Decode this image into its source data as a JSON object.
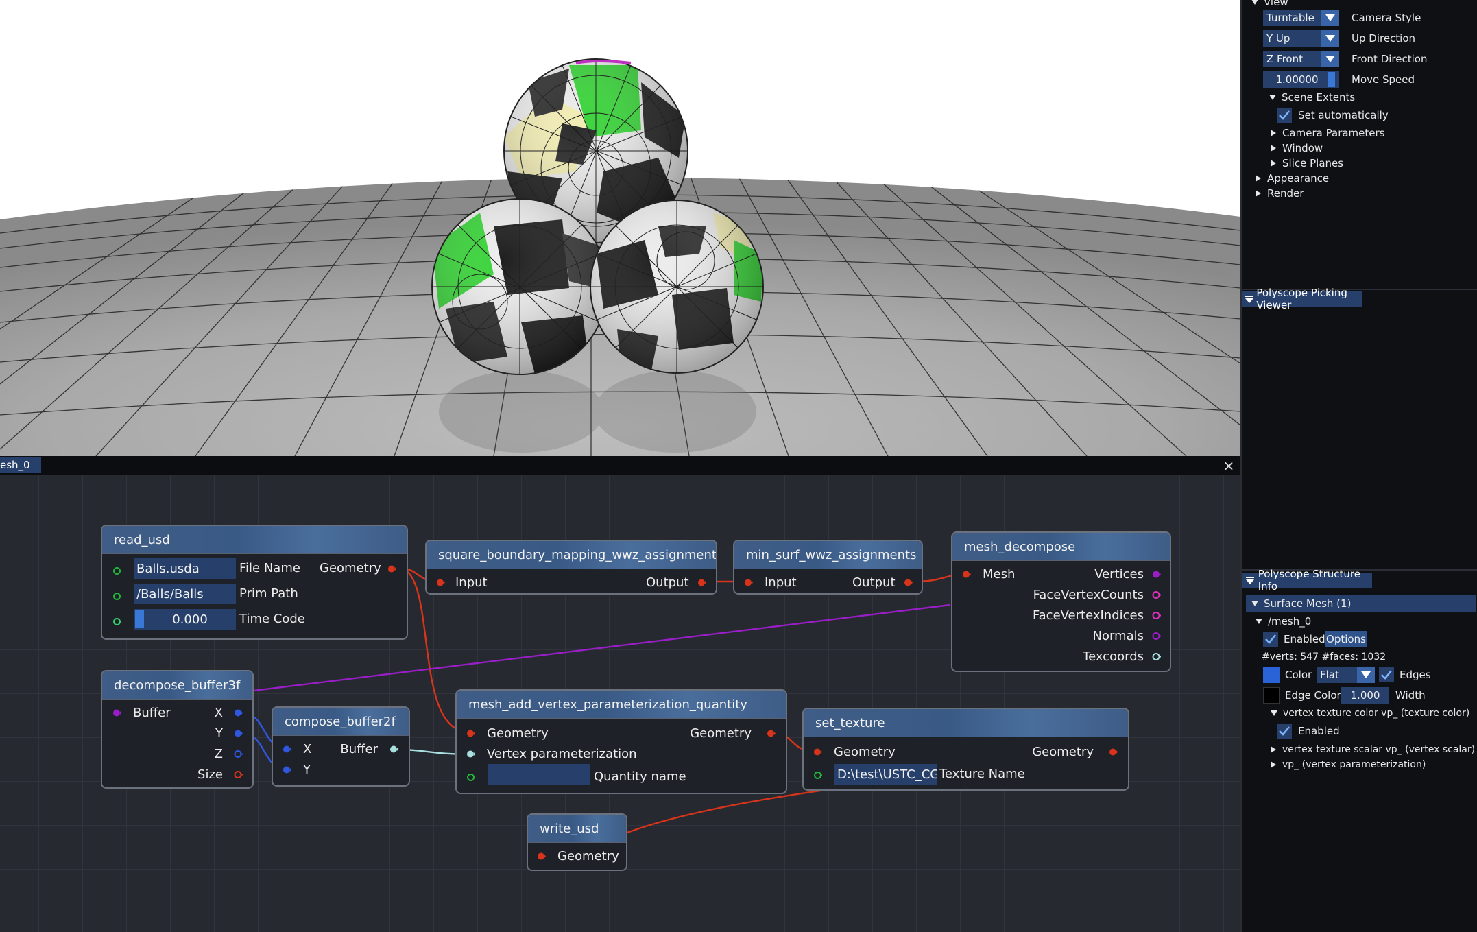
{
  "right_panel": {
    "view_section": {
      "title": "View",
      "camera_style": {
        "value": "Turntable",
        "label": "Camera Style"
      },
      "up_direction": {
        "value": "Y Up",
        "label": "Up Direction"
      },
      "front_direction": {
        "value": "Z Front",
        "label": "Front Direction"
      },
      "move_speed": {
        "value": "1.00000",
        "label": "Move Speed"
      },
      "scene_extents": {
        "label": "Scene Extents",
        "set_automatically": "Set automatically"
      },
      "collapsed_items": [
        "Camera Parameters",
        "Window",
        "Slice Planes"
      ],
      "top_items": [
        "Appearance",
        "Render"
      ]
    },
    "picking_viewer": {
      "title": "Polyscope Picking Viewer"
    },
    "structure_info": {
      "title": "Polyscope Structure Info",
      "surface_mesh": "Surface Mesh (1)",
      "mesh_name": "/mesh_0",
      "enabled": "Enabled",
      "options": "Options",
      "stats": "#verts: 547  #faces: 1032",
      "color_label": "Color",
      "shade": "Flat",
      "edges": "Edges",
      "edge_color": "Edge Color",
      "width_value": "1.000",
      "width_label": "Width",
      "quantities": [
        "vertex texture color vp_ (texture color)",
        "vertex texture scalar vp_ (vertex scalar)",
        "vp_ (vertex parameterization)"
      ],
      "quantity_enabled": "Enabled",
      "colors": {
        "mesh_color": "#2a62d8",
        "edge_color": "#000000"
      }
    }
  },
  "editor": {
    "tab": "esh_0",
    "close": "×",
    "nodes": {
      "read_usd": {
        "title": "read_usd",
        "file_value": "Balls.usda",
        "file_label": "File Name",
        "prim_value": "/Balls/Balls",
        "prim_label": "Prim Path",
        "time_value": "0.000",
        "time_label": "Time Code",
        "out": "Geometry"
      },
      "square_boundary": {
        "title": "square_boundary_mapping_wwz_assignments",
        "in": "Input",
        "out": "Output"
      },
      "min_surf": {
        "title": "min_surf_wwz_assignments",
        "in": "Input",
        "out": "Output"
      },
      "mesh_decompose": {
        "title": "mesh_decompose",
        "in": "Mesh",
        "outs": [
          "Vertices",
          "FaceVertexCounts",
          "FaceVertexIndices",
          "Normals",
          "Texcoords"
        ]
      },
      "decompose_buffer3f": {
        "title": "decompose_buffer3f",
        "in": "Buffer",
        "outs": [
          "X",
          "Y",
          "Z",
          "Size"
        ]
      },
      "compose_buffer2f": {
        "title": "compose_buffer2f",
        "ins": [
          "X",
          "Y"
        ],
        "out": "Buffer"
      },
      "mesh_add_vp": {
        "title": "mesh_add_vertex_parameterization_quantity",
        "in1": "Geometry",
        "in2": "Vertex parameterization",
        "in3_label": "Quantity name",
        "in3_value": "",
        "out": "Geometry"
      },
      "set_texture": {
        "title": "set_texture",
        "in1": "Geometry",
        "tex_value": "D:\\test\\USTC_CG",
        "tex_label": "Texture Name",
        "out": "Geometry"
      },
      "write_usd": {
        "title": "write_usd",
        "in": "Geometry"
      }
    },
    "pin_colors": {
      "geometry": "#d8341b",
      "buffer": "#9a1ec8",
      "float": "#2f57e0",
      "string": "#22b83a",
      "float2": "#a8e0e0"
    }
  }
}
